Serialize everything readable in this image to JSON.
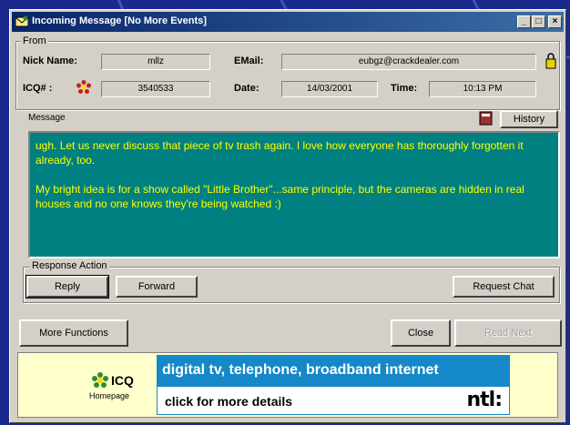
{
  "window": {
    "title": "Incoming Message [No More Events]",
    "controls": {
      "minimize": "_",
      "maximize": "□",
      "close": "×"
    }
  },
  "from": {
    "group_label": "From",
    "nick_label": "Nick Name:",
    "nick_value": "mllz",
    "email_label": "EMail:",
    "email_value": "eubgz@crackdealer.com",
    "icq_label": "ICQ# :",
    "icq_value": "3540533",
    "date_label": "Date:",
    "date_value": "14/03/2001",
    "time_label": "Time:",
    "time_value": "10:13 PM"
  },
  "message": {
    "label": "Message",
    "history_button": "History",
    "paragraphs": [
      "ugh. Let us never discuss that piece of tv trash again. I love how everyone has thoroughly forgotten it already, too.",
      "My bright idea is for a show called \"Little Brother\"...same principle, but the cameras are hidden in real houses and no one knows they're being watched :)"
    ]
  },
  "response": {
    "group_label": "Response Action",
    "reply_button": "Reply",
    "forward_button": "Forward",
    "request_chat_button": "Request Chat"
  },
  "footer": {
    "more_functions_button": "More Functions",
    "close_button": "Close",
    "read_next_button": "Read Next"
  },
  "ad": {
    "logo_text": "ICQ",
    "logo_sub": "Homepage",
    "headline": "digital tv, telephone, broadband internet",
    "cta": "click for more details",
    "brand": "ntl:"
  },
  "colors": {
    "message_bg": "#008080",
    "message_text": "#ffff00",
    "title_start": "#0a246a",
    "title_end": "#3a6ea5",
    "banner_blue": "#1488c8",
    "icq_flower": "#2e8b2e"
  },
  "icons": {
    "title": "icq-mail-icon",
    "lock": "lock-icon",
    "icq_status": "icq-flower-icon",
    "history": "book-icon"
  }
}
